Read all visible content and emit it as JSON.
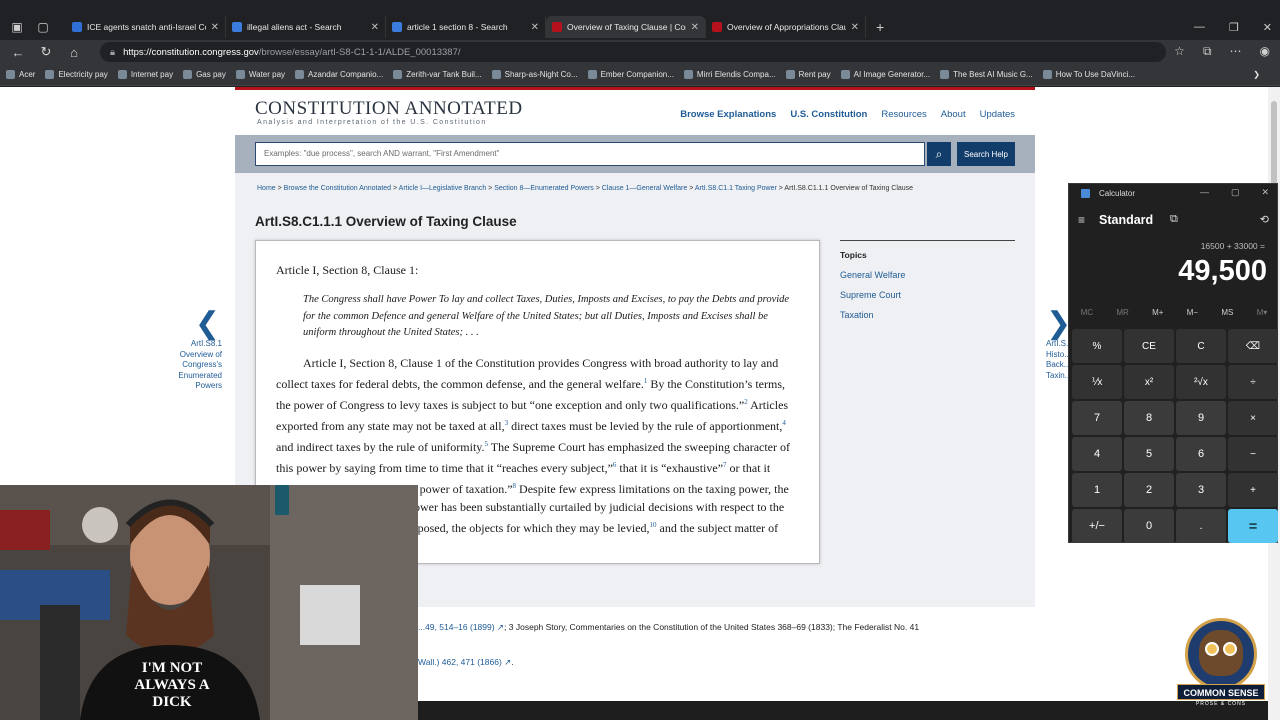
{
  "browser": {
    "tabs": [
      {
        "label": "ICE agents snatch anti-Israel Colu",
        "color": "#2f6fd6"
      },
      {
        "label": "illegal aliens act - Search",
        "color": "#3b7ddd"
      },
      {
        "label": "article 1 section 8 - Search",
        "color": "#3b7ddd"
      },
      {
        "label": "Overview of Taxing Clause | Const",
        "color": "#b5121b"
      },
      {
        "label": "Overview of Appropriations Claus",
        "color": "#b5121b"
      }
    ],
    "url_host": "https://constitution.congress.gov",
    "url_path": "/browse/essay/artI-S8-C1-1-1/ALDE_00013387/",
    "bookmarks": [
      "Acer",
      "Electricity pay",
      "Internet pay",
      "Gas pay",
      "Water pay",
      "Azandar Companio...",
      "Zerith-var Tank Buil...",
      "Sharp-as-Night Co...",
      "Ember Companion...",
      "Mirri Elendis Compa...",
      "Rent pay",
      "AI Image Generator...",
      "The Best AI Music G...",
      "How To Use DaVinci..."
    ]
  },
  "site": {
    "logo_title": "CONSTITUTION ANNOTATED",
    "logo_sub": "Analysis and Interpretation of the U.S. Constitution",
    "nav": [
      "Browse Explanations",
      "U.S. Constitution",
      "Resources",
      "About",
      "Updates"
    ],
    "search_placeholder": "Examples: \"due process\", search AND warrant, \"First Amendment\"",
    "search_help": "Search Help"
  },
  "breadcrumb": [
    "Home",
    "Browse the Constitution Annotated",
    "Article I—Legislative Branch",
    "Section 8—Enumerated Powers",
    "Clause 1—General Welfare",
    "ArtI.S8.C1.1 Taxing Power",
    "ArtI.S8.C1.1.1 Overview of Taxing Clause"
  ],
  "page_title": "ArtI.S8.C1.1.1 Overview of Taxing Clause",
  "essay": {
    "clause_heading": "Article I, Section 8, Clause 1:",
    "quote": "The Congress shall have Power To lay and collect Taxes, Duties, Imposts and Excises, to pay the Debts and provide for the common Defence and general Welfare of the United States; but all Duties, Imposts and Excises shall be uniform throughout the United States; . . .",
    "p1": "Article I, Section 8, Clause 1 of the Constitution provides Congress with broad authority to lay and collect taxes for federal debts, the common defense, and the general welfare.",
    "p2": " By the Constitution’s terms, the power of Congress to levy taxes is subject to but “one exception and only two qualifications.”",
    "p3": " Articles exported from any state may not be taxed at all,",
    "p4": " direct taxes must be levied by the rule of apportionment,",
    "p5": " and indirect taxes by the rule of uniformity.",
    "p6": " The Supreme Court has emphasized the sweeping character of this power by saying from time to time that it “reaches every subject,”",
    "p7": " that it is “exhaustive”",
    "p8": " or that it “embraces every conceivable power of taxation.”",
    "p9": " Despite few express limitations on the taxing power, the scope of Congress’s taxing power has been substantially curtailed by judicial decisions with respect to the manner in which taxes are imposed, the objects for which they may be levied,",
    "p10": " and the subject matter of",
    "fn": [
      "1",
      "2",
      "3",
      "4",
      "5",
      "6",
      "7",
      "8",
      "10"
    ]
  },
  "topics": {
    "heading": "Topics",
    "items": [
      "General Welfare",
      "Supreme Court",
      "Taxation"
    ]
  },
  "prev": {
    "label": "ArtI.S8.1 Overview of Congress's Enumerated Powers"
  },
  "next": {
    "label": "ArtI.S... Histo... Back... Taxin..."
  },
  "footnotes": {
    "f1_link": "...49, 514–16 (1899)",
    "f1_text": "; 3 Joseph Story, Commentaries on the Constitution of the United States 368–69 (1833); The Federalist No. 41",
    "f2_link": "Wall.) 462, 471 (1866)",
    "f2_text": "."
  },
  "calculator": {
    "title": "Calculator",
    "mode": "Standard",
    "expression": "16500 + 33000 =",
    "display": "49,500",
    "memory": [
      "MC",
      "MR",
      "M+",
      "M−",
      "MS",
      "M▾"
    ],
    "keys": [
      "%",
      "CE",
      "C",
      "⌫",
      "⅟x",
      "x²",
      "²√x",
      "÷",
      "7",
      "8",
      "9",
      "×",
      "4",
      "5",
      "6",
      "−",
      "1",
      "2",
      "3",
      "+",
      "+/−",
      "0",
      ".",
      "="
    ]
  },
  "overlay": {
    "badge_title": "COMMON SENSE",
    "badge_sub": "PROSE & CONS",
    "shirt_text": "I'M NOT ALWAYS A DICK"
  }
}
